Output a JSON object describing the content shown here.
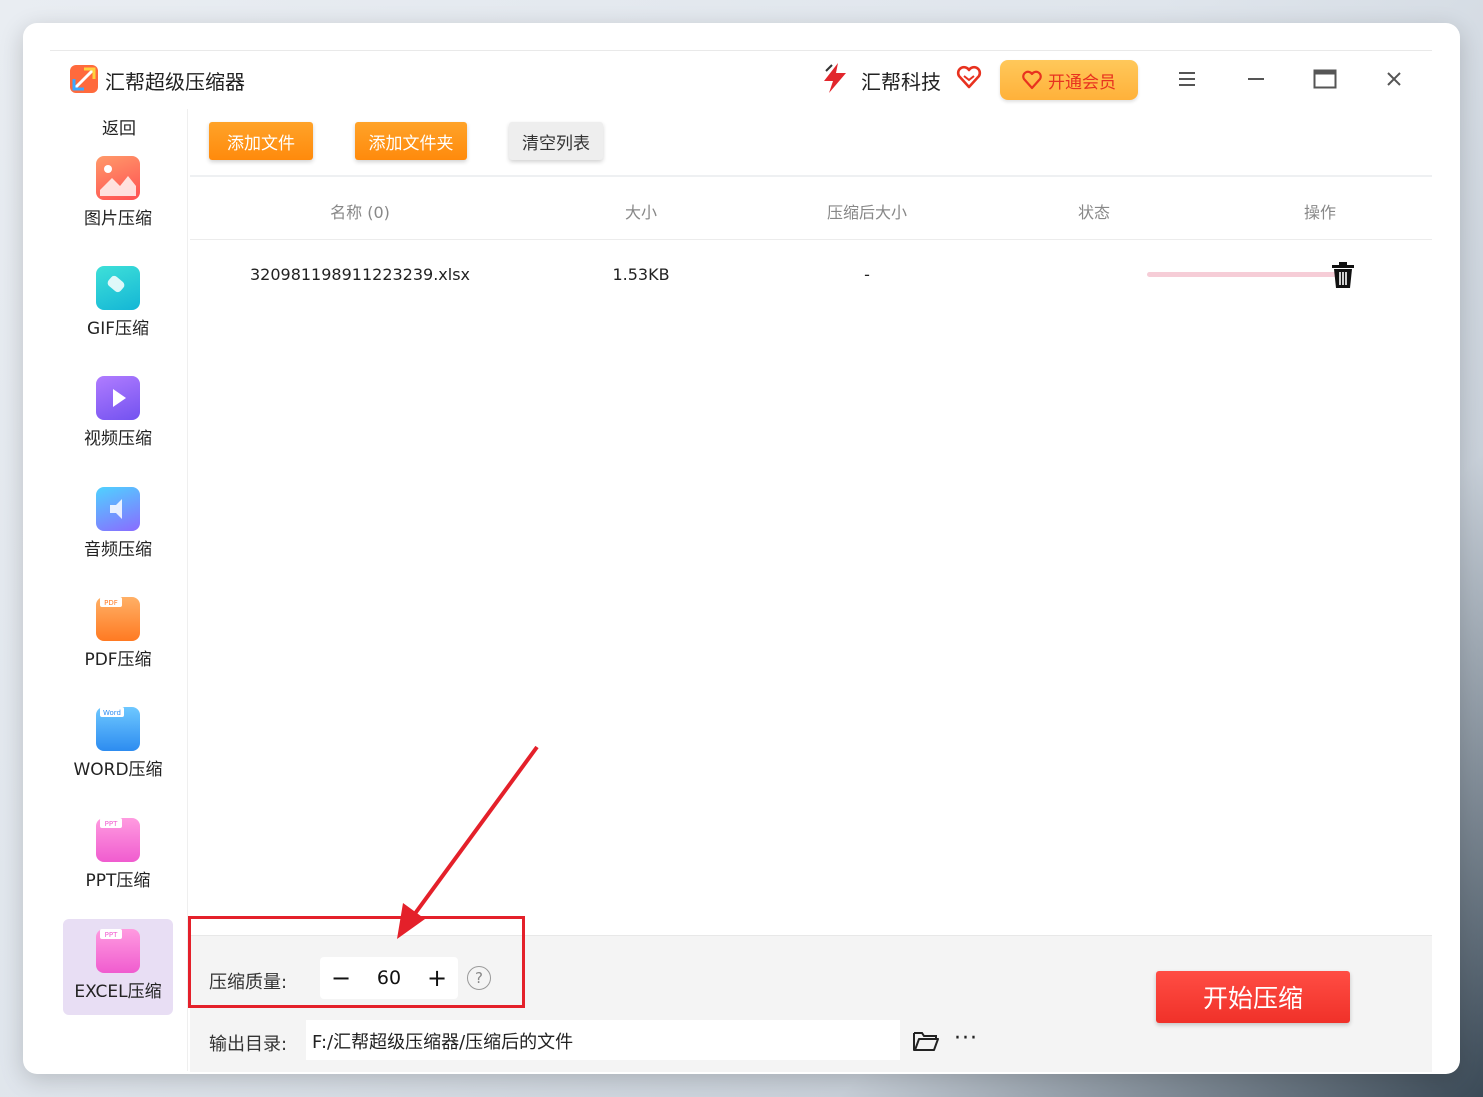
{
  "app": {
    "title": "汇帮超级压缩器",
    "brand_name": "汇帮科技",
    "vip_label": "开通会员"
  },
  "window_controls": {
    "menu_icon": "menu-icon",
    "minimize_icon": "minimize-icon",
    "maximize_icon": "maximize-icon",
    "close_icon": "close-icon"
  },
  "sidebar": {
    "back_label": "返回",
    "items": [
      {
        "label": "图片压缩",
        "icon": "image-compress-icon",
        "active": false
      },
      {
        "label": "GIF压缩",
        "icon": "gif-compress-icon",
        "active": false
      },
      {
        "label": "视频压缩",
        "icon": "video-compress-icon",
        "active": false
      },
      {
        "label": "音频压缩",
        "icon": "audio-compress-icon",
        "active": false
      },
      {
        "label": "PDF压缩",
        "icon": "pdf-compress-icon",
        "active": false
      },
      {
        "label": "WORD压缩",
        "icon": "word-compress-icon",
        "active": false
      },
      {
        "label": "PPT压缩",
        "icon": "ppt-compress-icon",
        "active": false
      },
      {
        "label": "EXCEL压缩",
        "icon": "excel-compress-icon",
        "active": true
      }
    ],
    "badges": {
      "pdf": "PDF",
      "word": "Word",
      "ppt": "PPT",
      "excel": "PPT"
    }
  },
  "toolbar": {
    "add_file": "添加文件",
    "add_folder": "添加文件夹",
    "clear_list": "清空列表"
  },
  "table": {
    "headers": [
      "名称 (0)",
      "大小",
      "压缩后大小",
      "状态",
      "操作"
    ],
    "rows": [
      {
        "name": "320981198911223239.xlsx",
        "size": "1.53KB",
        "compressed_size": "-",
        "status_progress": 1.0,
        "action_icon": "trash-icon"
      }
    ]
  },
  "bottom": {
    "quality_label": "压缩质量:",
    "quality_value": "60",
    "minus": "−",
    "plus": "+",
    "help": "?",
    "output_label": "输出目录:",
    "output_path": "F:/汇帮超级压缩器/压缩后的文件",
    "more": "···",
    "start_label": "开始压缩"
  },
  "colors": {
    "orange_button": "#ff960f",
    "start_button": "#f53a31",
    "annotation_red": "#e4202a",
    "vip_gold": "#ffbb45",
    "progress_pink": "#f6cdd7",
    "active_item_bg": "#e8def4"
  }
}
